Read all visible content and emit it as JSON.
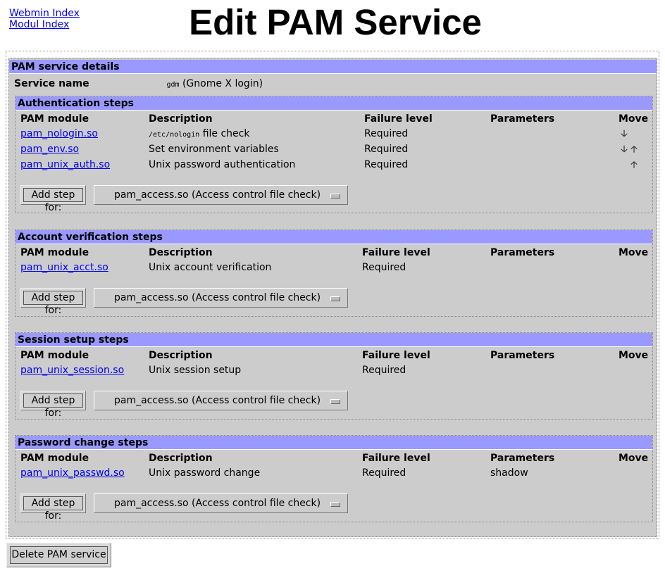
{
  "nav": {
    "webmin_index": "Webmin Index",
    "module_index": "Modul Index"
  },
  "page_title": "Edit PAM Service",
  "details": {
    "header": "PAM service details",
    "service_name_label": "Service name",
    "service_name_code": "gdm",
    "service_name_desc": "(Gnome X login)"
  },
  "columns": {
    "module": "PAM module",
    "description": "Description",
    "failure": "Failure level",
    "parameters": "Parameters",
    "move": "Move"
  },
  "auth": {
    "header": "Authentication steps",
    "rows": [
      {
        "module": "pam_nologin.so",
        "desc_code": "/etc/nologin",
        "desc": "file check",
        "failure": "Required",
        "params": "",
        "move": [
          "down"
        ]
      },
      {
        "module": "pam_env.so",
        "desc": "Set environment variables",
        "failure": "Required",
        "params": "",
        "move": [
          "down",
          "up"
        ]
      },
      {
        "module": "pam_unix_auth.so",
        "desc": "Unix password authentication",
        "failure": "Required",
        "params": "",
        "move": [
          "up"
        ]
      }
    ]
  },
  "account": {
    "header": "Account verification steps",
    "rows": [
      {
        "module": "pam_unix_acct.so",
        "desc": "Unix account verification",
        "failure": "Required",
        "params": ""
      }
    ]
  },
  "session": {
    "header": "Session setup steps",
    "rows": [
      {
        "module": "pam_unix_session.so",
        "desc": "Unix session setup",
        "failure": "Required",
        "params": ""
      }
    ]
  },
  "password": {
    "header": "Password change steps",
    "rows": [
      {
        "module": "pam_unix_passwd.so",
        "desc": "Unix password change",
        "failure": "Required",
        "params": "shadow"
      }
    ]
  },
  "add_step": {
    "button_label": "Add step for:",
    "selected_option": "pam_access.so (Access control file check)"
  },
  "delete_button": "Delete PAM service",
  "icons": {
    "down": "arrow-down-icon",
    "up": "arrow-up-icon"
  },
  "colors": {
    "header_bg": "#9999ff",
    "panel_bg": "#cccccc",
    "link": "#0000ee"
  }
}
